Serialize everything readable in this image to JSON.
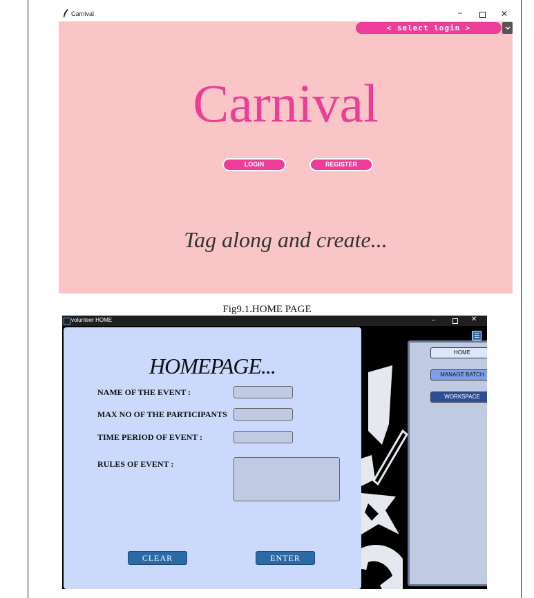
{
  "window1": {
    "title": "Carnival",
    "controls": {
      "minimize": "–",
      "close": "✕"
    },
    "select_login": "< select login >",
    "dropdown_icon": "chevron-down-icon",
    "heading": "Carnival",
    "login_label": "LOGIN",
    "register_label": "REGISTER",
    "tagline": "Tag along and create...",
    "colors": {
      "background": "#f9c5c6",
      "accent": "#ec3d98"
    }
  },
  "caption": "Fig9.1.HOME PAGE",
  "window2": {
    "title": "volunteer HOME",
    "controls": {
      "minimize": "–",
      "close": "✕"
    },
    "heading": "HOMEPAGE...",
    "fields": {
      "event_name": "NAME OF THE EVENT :",
      "max_participants": "MAX NO OF THE PARTICIPANTS",
      "time_period": "TIME PERIOD OF EVENT :",
      "rules": "RULES OF EVENT :"
    },
    "clear_label": "CLEAR",
    "enter_label": "ENTER",
    "menu_icon": "☰",
    "sidebar": {
      "home": "HOME",
      "manage": "MANAGE BATCH",
      "workspace": "WORKSPACE"
    },
    "colors": {
      "panel": "#cad9fc",
      "button": "#2c6aa6",
      "sidebar": "#c0cbe3"
    }
  }
}
